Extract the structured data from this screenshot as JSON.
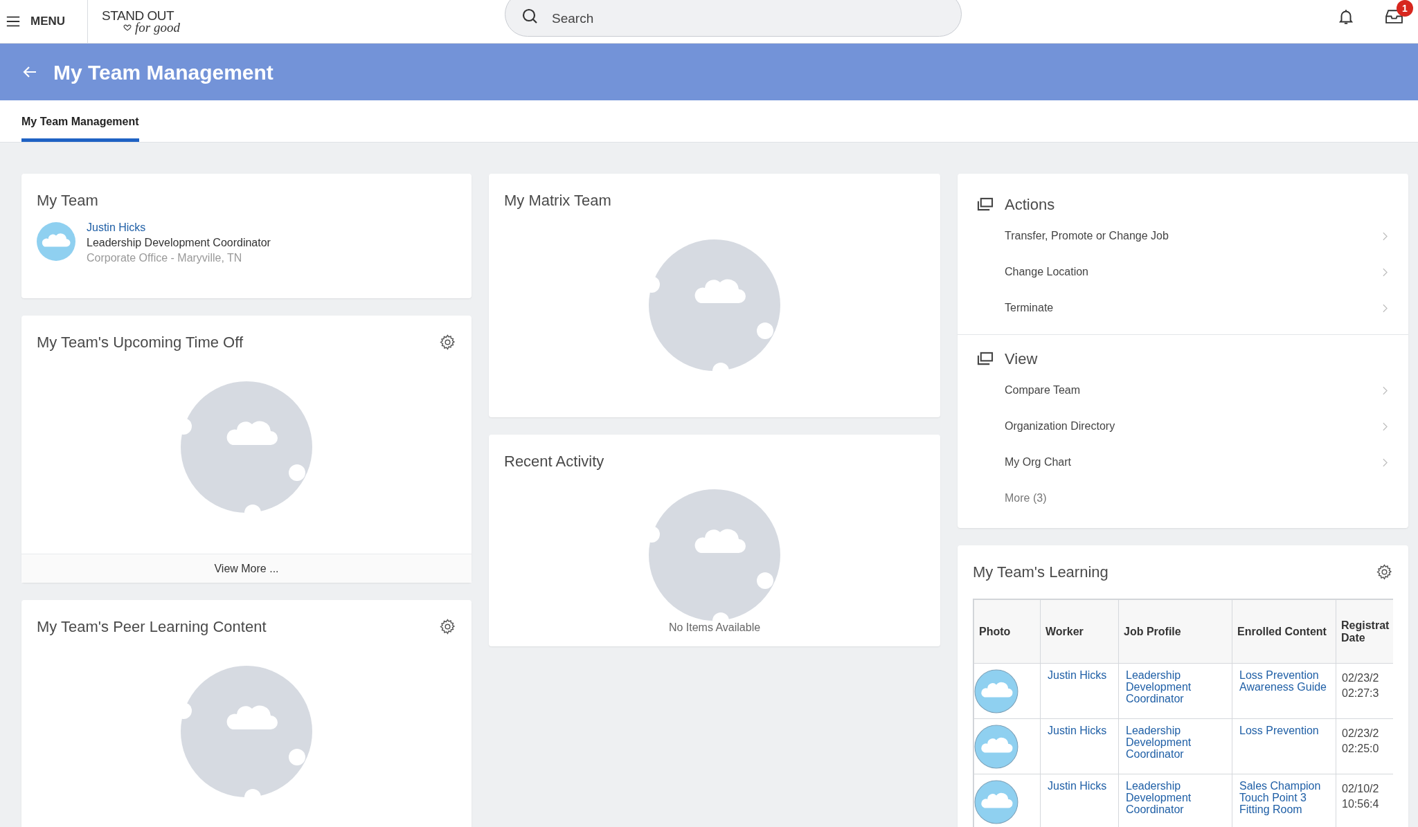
{
  "top_bar": {
    "menu_label": "MENU",
    "logo": {
      "line_1": "STAND OUT",
      "line_2": "for good"
    },
    "search": {
      "placeholder": "Search"
    },
    "inbox_badge": "1"
  },
  "header": {
    "title": "My Team Management"
  },
  "tabs": [
    {
      "label": "My Team Management",
      "selected": true
    }
  ],
  "my_team": {
    "title": "My Team",
    "members": [
      {
        "name": "Justin Hicks",
        "job": "Leadership Development Coordinator",
        "location": "Corporate Office - Maryville, TN"
      }
    ]
  },
  "upcoming_time_off": {
    "title": "My Team's Upcoming Time Off",
    "footer_link": "View More ..."
  },
  "peer_learning": {
    "title": "My Team's Peer Learning Content"
  },
  "matrix_team": {
    "title": "My Matrix Team"
  },
  "recent_activity": {
    "title": "Recent Activity",
    "empty_message": "No Items Available"
  },
  "action_groups": [
    {
      "title": "Actions",
      "items": [
        {
          "label": "Transfer, Promote or Change Job",
          "kind": "link"
        },
        {
          "label": "Change Location",
          "kind": "link"
        },
        {
          "label": "Terminate",
          "kind": "link"
        }
      ]
    },
    {
      "title": "View",
      "items": [
        {
          "label": "Compare Team",
          "kind": "link"
        },
        {
          "label": "Organization Directory",
          "kind": "link"
        },
        {
          "label": "My Org Chart",
          "kind": "link"
        },
        {
          "label": "More (3)",
          "kind": "more"
        }
      ]
    }
  ],
  "learning": {
    "title": "My Team's Learning",
    "columns": [
      "Photo",
      "Worker",
      "Job Profile",
      "Enrolled Content",
      "Registrat Date"
    ],
    "rows": [
      {
        "worker": "Justin Hicks",
        "job_profile": "Leadership Development Coordinator",
        "enrolled_content": "Loss Prevention Awareness Guide",
        "registration_date": "02/23/2",
        "registration_time": "02:27:3"
      },
      {
        "worker": "Justin Hicks",
        "job_profile": "Leadership Development Coordinator",
        "enrolled_content": "Loss Prevention",
        "registration_date": "02/23/2",
        "registration_time": "02:25:0"
      },
      {
        "worker": "Justin Hicks",
        "job_profile": "Leadership Development Coordinator",
        "enrolled_content": "Sales Champion Touch Point 3 Fitting Room",
        "registration_date": "02/10/2",
        "registration_time": "10:56:4"
      }
    ]
  }
}
